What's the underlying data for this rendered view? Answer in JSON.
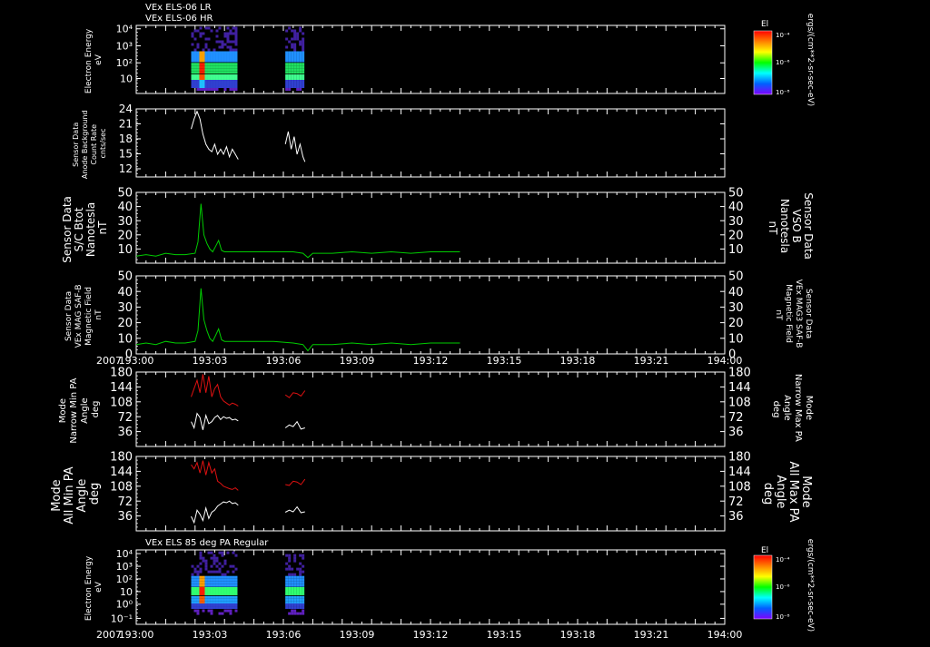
{
  "header": {
    "line1": "VEx ELS-06 LR",
    "line2": "VEx ELS-06 HR"
  },
  "x_axis": {
    "year": "2007",
    "ticks": [
      "193:00",
      "193:03",
      "193:06",
      "193:09",
      "193:12",
      "193:15",
      "193:18",
      "193:21",
      "194:00"
    ]
  },
  "colorbar": {
    "title": "El",
    "unit": "ergs/(cm**2-sr-sec-eV)",
    "ticks": [
      "10⁻⁴",
      "10⁻⁶",
      "10⁻⁸"
    ],
    "colors": [
      "#ff0000",
      "#ff8000",
      "#ffff00",
      "#00ff00",
      "#00ffff",
      "#0060ff",
      "#8000ff"
    ]
  },
  "colors": {
    "background": "#000000",
    "axes": "#ffffff",
    "green_trace": "#00cc00",
    "green_label": "#00dd00",
    "red_trace": "#dd1111",
    "red_label": "#dd1111",
    "white_trace": "#ffffff"
  },
  "panels": {
    "p1": {
      "label": [
        "Electron Energy",
        "eV"
      ],
      "yticks": [
        "10⁴",
        "10³",
        "10²",
        "10"
      ]
    },
    "p2": {
      "label": [
        "Sensor Data",
        "Anode Background",
        "Count Rate",
        "cnts/sec"
      ],
      "yticks": [
        "24",
        "21",
        "18",
        "15",
        "12"
      ]
    },
    "p3": {
      "label": [
        "Sensor Data",
        "S/C Btot",
        "Nanotesla",
        "nT"
      ],
      "right_label": [
        "Sensor Data",
        "VSO B",
        "Nanotesla",
        "nT"
      ],
      "yticks": [
        "50",
        "40",
        "30",
        "20",
        "10"
      ]
    },
    "p4": {
      "label": [
        "Sensor Data",
        "VEx MAG SAF-B",
        "Magnetic Field",
        "nT"
      ],
      "right_label": [
        "Sensor Data",
        "VEx MAG3 SAF-B",
        "Magnetic Field",
        "nT"
      ],
      "yticks": [
        "50",
        "40",
        "30",
        "20",
        "10",
        "0"
      ]
    },
    "p5": {
      "label": [
        "Mode",
        "Narrow Min PA",
        "Angle",
        "deg"
      ],
      "right_label": [
        "Mode",
        "Narrow Max PA",
        "Angle",
        "deg"
      ],
      "yticks": [
        "180",
        "144",
        "108",
        "72",
        "36"
      ]
    },
    "p6": {
      "label": [
        "Mode",
        "All Min PA",
        "Angle",
        "deg"
      ],
      "right_label": [
        "Mode",
        "All Max PA",
        "Angle",
        "deg"
      ],
      "yticks": [
        "180",
        "144",
        "108",
        "72",
        "36"
      ]
    },
    "p7": {
      "title": "VEx ELS 85 deg PA Regular",
      "label": [
        "Electron Energy",
        "eV"
      ],
      "yticks": [
        "10⁴",
        "10³",
        "10²",
        "10",
        "10⁰",
        "10⁻¹"
      ]
    }
  },
  "chart_data": [
    {
      "type": "heatmap",
      "x_unit": "minutes after 193:00",
      "xlim": [
        0,
        60
      ],
      "ylabel": "Electron Energy eV",
      "yscale": "log",
      "ylim": [
        1,
        10000
      ],
      "data_intervals": [
        [
          5.6,
          10.4
        ],
        [
          15.2,
          17.2
        ]
      ],
      "peak_flux_interval": [
        6.3,
        7.0
      ]
    },
    {
      "type": "line",
      "x_unit": "minutes after 193:00",
      "xlim": [
        0,
        60
      ],
      "ylim": [
        10.5,
        24
      ],
      "ylabel": "Sensor Data Anode Background Count Rate cnts/sec",
      "series": [
        {
          "x": [
            5.6,
            5.9,
            6.2,
            6.5,
            6.8,
            7.1,
            7.4,
            7.7,
            8.0,
            8.3,
            8.6,
            8.9,
            9.2,
            9.5,
            9.8,
            10.1,
            10.4
          ],
          "values": [
            20,
            22,
            23.5,
            22,
            19,
            17,
            16,
            15.5,
            17,
            15,
            16,
            15,
            16.5,
            14.5,
            16,
            15,
            14
          ]
        },
        {
          "x": [
            15.2,
            15.5,
            15.8,
            16.1,
            16.4,
            16.7,
            17.0,
            17.2
          ],
          "values": [
            17,
            19.5,
            16,
            18.5,
            15,
            17,
            14.5,
            13.5
          ]
        }
      ]
    },
    {
      "type": "line",
      "x_unit": "minutes after 193:00",
      "xlim": [
        0,
        60
      ],
      "ylim": [
        0,
        50
      ],
      "series": [
        {
          "x": [
            0,
            1,
            2,
            3,
            4,
            5,
            6,
            6.3,
            6.6,
            6.9,
            7.2,
            7.5,
            7.8,
            8.1,
            8.4,
            8.7,
            9,
            10,
            12,
            14,
            16,
            17,
            17.5,
            18,
            20,
            22,
            24,
            26,
            28,
            30,
            33
          ],
          "values": [
            5,
            6,
            5,
            7,
            6,
            6,
            7,
            15,
            42,
            20,
            14,
            10,
            8,
            12,
            16,
            9,
            8,
            8,
            8,
            8,
            8,
            7,
            4,
            7,
            7,
            8,
            7,
            8,
            7,
            8,
            8
          ]
        }
      ]
    },
    {
      "type": "line",
      "x_unit": "minutes after 193:00",
      "xlim": [
        0,
        60
      ],
      "ylim": [
        0,
        50
      ],
      "series": [
        {
          "x": [
            0,
            1,
            2,
            3,
            4,
            5,
            6,
            6.3,
            6.6,
            6.9,
            7.2,
            7.5,
            7.8,
            8.1,
            8.4,
            8.7,
            9,
            10,
            12,
            14,
            16,
            17,
            17.5,
            18,
            20,
            22,
            24,
            26,
            28,
            30,
            33
          ],
          "values": [
            6,
            7,
            6,
            8,
            7,
            7,
            8,
            15,
            42,
            22,
            15,
            10,
            8,
            12,
            16,
            9,
            8,
            8,
            8,
            8,
            7,
            6,
            2,
            6,
            6,
            7,
            6,
            7,
            6,
            7,
            7
          ]
        }
      ]
    },
    {
      "type": "line",
      "x_unit": "minutes after 193:00",
      "xlim": [
        0,
        60
      ],
      "ylim": [
        0,
        180
      ],
      "ylabel": "Mode Narrow Min PA Angle deg",
      "series": [
        {
          "x": [
            5.6,
            5.9,
            6.2,
            6.5,
            6.8,
            7.1,
            7.4,
            7.7,
            8.0,
            8.3,
            8.6,
            8.9,
            9.2,
            9.5,
            9.8,
            10.1,
            10.4
          ],
          "values": [
            60,
            45,
            80,
            70,
            40,
            75,
            55,
            60,
            70,
            75,
            65,
            72,
            68,
            70,
            64,
            66,
            62
          ]
        },
        {
          "x": [
            5.6,
            5.9,
            6.2,
            6.5,
            6.8,
            7.1,
            7.4,
            7.7,
            8.0,
            8.3,
            8.6,
            8.9,
            9.2,
            9.5,
            9.8,
            10.1,
            10.4
          ],
          "values": [
            120,
            140,
            160,
            130,
            175,
            130,
            170,
            120,
            140,
            150,
            120,
            110,
            105,
            100,
            105,
            102,
            98
          ]
        },
        {
          "x": [
            15.2,
            15.6,
            16.0,
            16.4,
            16.8,
            17.2
          ],
          "values": [
            45,
            52,
            48,
            60,
            42,
            45
          ]
        },
        {
          "x": [
            15.2,
            15.6,
            16.0,
            16.4,
            16.8,
            17.2
          ],
          "values": [
            125,
            118,
            130,
            128,
            122,
            135
          ]
        }
      ]
    },
    {
      "type": "line",
      "x_unit": "minutes after 193:00",
      "xlim": [
        0,
        60
      ],
      "ylim": [
        0,
        180
      ],
      "ylabel": "Mode All Min PA Angle deg",
      "series": [
        {
          "x": [
            5.6,
            5.9,
            6.2,
            6.5,
            6.8,
            7.1,
            7.4,
            7.7,
            8.0,
            8.3,
            8.6,
            8.9,
            9.2,
            9.5,
            9.8,
            10.1,
            10.4
          ],
          "values": [
            35,
            20,
            50,
            40,
            25,
            55,
            30,
            45,
            50,
            60,
            65,
            70,
            68,
            72,
            66,
            68,
            62
          ]
        },
        {
          "x": [
            5.6,
            5.9,
            6.2,
            6.5,
            6.8,
            7.1,
            7.4,
            7.7,
            8.0,
            8.3,
            8.6,
            8.9,
            9.2,
            9.5,
            9.8,
            10.1,
            10.4
          ],
          "values": [
            160,
            150,
            165,
            140,
            170,
            135,
            165,
            140,
            150,
            120,
            115,
            108,
            105,
            102,
            100,
            104,
            98
          ]
        },
        {
          "x": [
            15.2,
            15.6,
            16.0,
            16.4,
            16.8,
            17.2
          ],
          "values": [
            45,
            50,
            46,
            58,
            44,
            46
          ]
        },
        {
          "x": [
            15.2,
            15.6,
            16.0,
            16.4,
            16.8,
            17.2
          ],
          "values": [
            112,
            110,
            120,
            118,
            112,
            125
          ]
        }
      ]
    },
    {
      "type": "heatmap",
      "title": "VEx ELS 85 deg PA Regular",
      "x_unit": "minutes after 193:00",
      "xlim": [
        0,
        60
      ],
      "ylabel": "Electron Energy eV",
      "yscale": "log",
      "ylim": [
        0.1,
        10000
      ],
      "data_intervals": [
        [
          5.6,
          10.4
        ],
        [
          15.2,
          17.2
        ]
      ],
      "peak_flux_interval": [
        6.3,
        7.0
      ]
    }
  ]
}
